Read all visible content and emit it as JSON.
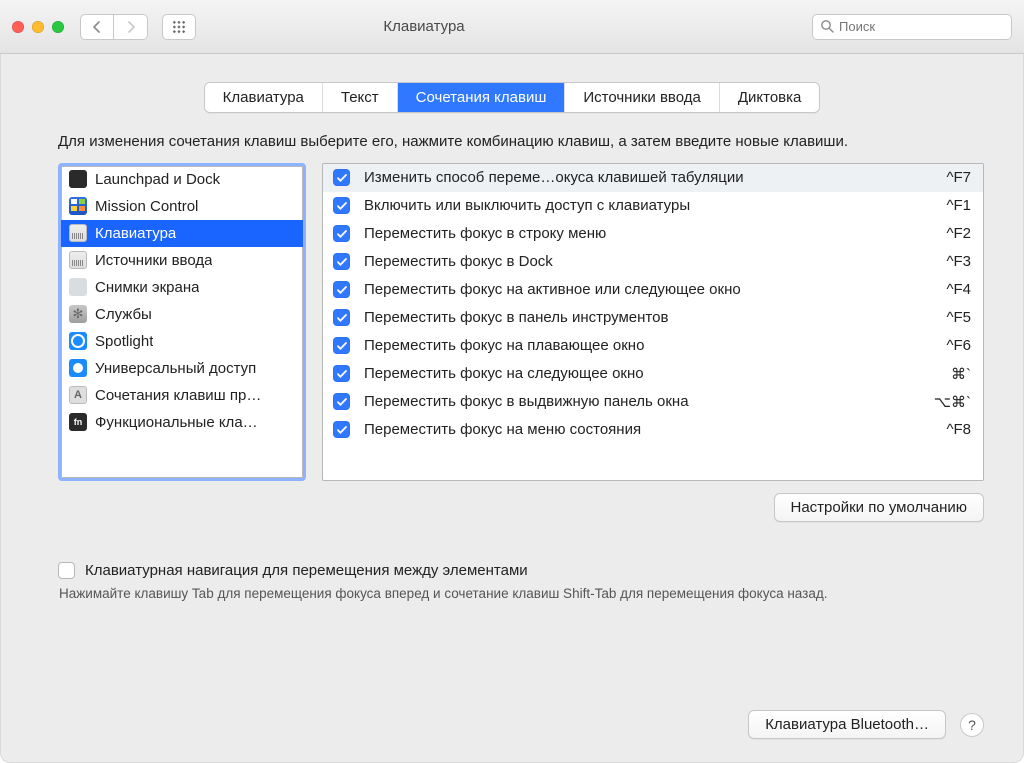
{
  "window": {
    "title": "Клавиатура"
  },
  "search": {
    "placeholder": "Поиск"
  },
  "tabs": [
    {
      "label": "Клавиатура",
      "active": false
    },
    {
      "label": "Текст",
      "active": false
    },
    {
      "label": "Сочетания клавиш",
      "active": true
    },
    {
      "label": "Источники ввода",
      "active": false
    },
    {
      "label": "Диктовка",
      "active": false
    }
  ],
  "description": "Для изменения сочетания клавиш выберите его, нажмите комбинацию клавиш, а затем введите новые клавиши.",
  "categories": [
    {
      "icon": "launch",
      "label": "Launchpad и Dock",
      "selected": false
    },
    {
      "icon": "mc",
      "label": "Mission Control",
      "selected": false
    },
    {
      "icon": "kb",
      "label": "Клавиатура",
      "selected": true
    },
    {
      "icon": "kb",
      "label": "Источники ввода",
      "selected": false
    },
    {
      "icon": "screenshot",
      "label": "Снимки экрана",
      "selected": false
    },
    {
      "icon": "services",
      "label": "Службы",
      "selected": false
    },
    {
      "icon": "spotlight",
      "label": "Spotlight",
      "selected": false
    },
    {
      "icon": "access",
      "label": "Универсальный доступ",
      "selected": false
    },
    {
      "icon": "appshort",
      "label": "Сочетания клавиш пр…",
      "selected": false
    },
    {
      "icon": "fn",
      "label": "Функциональные кла…",
      "selected": false
    }
  ],
  "shortcuts": [
    {
      "checked": true,
      "label": "Изменить способ переме…окуса клавишей табуляции",
      "key": "^F7",
      "selected": true
    },
    {
      "checked": true,
      "label": "Включить или выключить доступ с клавиатуры",
      "key": "^F1",
      "selected": false
    },
    {
      "checked": true,
      "label": "Переместить фокус в строку меню",
      "key": "^F2",
      "selected": false
    },
    {
      "checked": true,
      "label": "Переместить фокус в Dock",
      "key": "^F3",
      "selected": false
    },
    {
      "checked": true,
      "label": "Переместить фокус на активное или следующее окно",
      "key": "^F4",
      "selected": false
    },
    {
      "checked": true,
      "label": "Переместить фокус в панель инструментов",
      "key": "^F5",
      "selected": false
    },
    {
      "checked": true,
      "label": "Переместить фокус на плавающее окно",
      "key": "^F6",
      "selected": false
    },
    {
      "checked": true,
      "label": "Переместить фокус на следующее окно",
      "key": "⌘`",
      "selected": false
    },
    {
      "checked": true,
      "label": "Переместить фокус в выдвижную панель окна",
      "key": "⌥⌘`",
      "selected": false
    },
    {
      "checked": true,
      "label": "Переместить фокус на меню состояния",
      "key": "^F8",
      "selected": false
    }
  ],
  "buttons": {
    "defaults": "Настройки по умолчанию",
    "bluetooth": "Клавиатура Bluetooth…"
  },
  "kbnav": {
    "label": "Клавиатурная навигация для перемещения между элементами",
    "checked": false,
    "note": "Нажимайте клавишу Tab для перемещения фокуса вперед и сочетание клавиш Shift-Tab для перемещения фокуса назад."
  }
}
